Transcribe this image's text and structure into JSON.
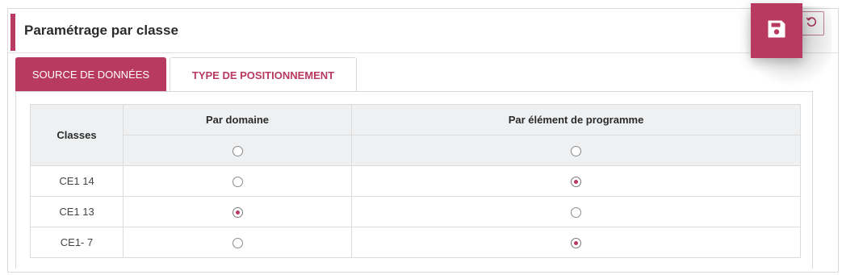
{
  "panel": {
    "title": "Paramétrage par classe"
  },
  "actions": {
    "save_icon": "floppy-disk-icon",
    "reset_icon": "undo-icon"
  },
  "tabs": [
    {
      "label": "SOURCE DE DONNÉES",
      "active": false
    },
    {
      "label": "TYPE DE POSITIONNEMENT",
      "active": true
    }
  ],
  "table": {
    "header_classes": "Classes",
    "header_domain": "Par domaine",
    "header_element": "Par élément de programme",
    "header_all": {
      "domain": false,
      "element": false
    },
    "rows": [
      {
        "classe": "CE1 14",
        "domain": false,
        "element": true
      },
      {
        "classe": "CE1 13",
        "domain": true,
        "element": false
      },
      {
        "classe": "CE1- 7",
        "domain": false,
        "element": true
      }
    ]
  },
  "colors": {
    "accent": "#b83a61",
    "header_bg": "#eef0f2"
  }
}
